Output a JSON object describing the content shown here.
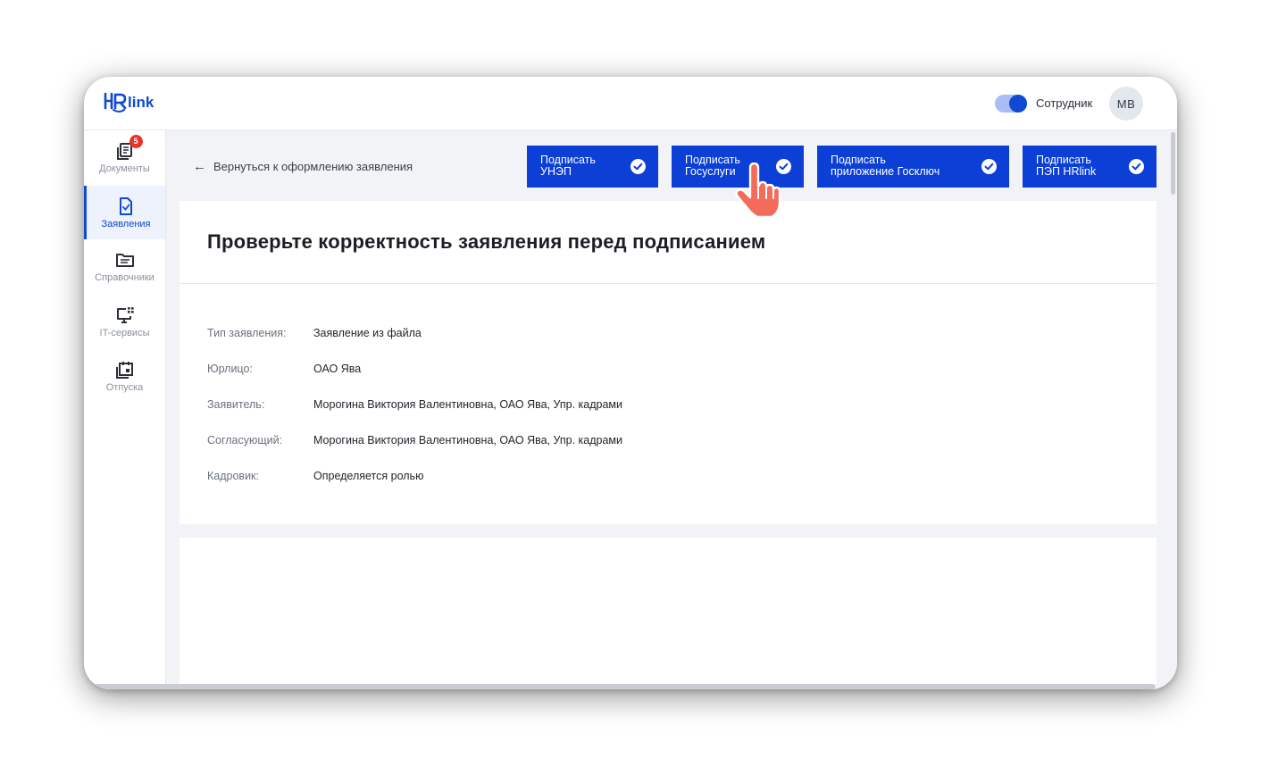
{
  "header": {
    "logo_text": "HRlink",
    "role_toggle_on": true,
    "role_label": "Сотрудник",
    "avatar_initials": "МВ"
  },
  "sidebar": {
    "items": [
      {
        "label": "Документы",
        "icon": "documents-icon",
        "badge": "5"
      },
      {
        "label": "Заявления",
        "icon": "application-icon",
        "active": true
      },
      {
        "label": "Справочники",
        "icon": "folder-icon"
      },
      {
        "label": "IT-сервисы",
        "icon": "it-services-icon"
      },
      {
        "label": "Отпуска",
        "icon": "calendar-icon"
      }
    ]
  },
  "toolbar": {
    "back_label": "Вернуться к оформлению заявления",
    "buttons": [
      {
        "line1": "Подписать",
        "line2": "УНЭП"
      },
      {
        "line1": "Подписать",
        "line2": "Госуслуги"
      },
      {
        "line1": "Подписать",
        "line2": "приложение Госключ"
      },
      {
        "line1": "Подписать",
        "line2": "ПЭП HRlink"
      }
    ]
  },
  "main": {
    "title": "Проверьте корректность заявления перед подписанием",
    "fields": [
      {
        "key": "Тип заявления:",
        "value": "Заявление из файла"
      },
      {
        "key": "Юрлицо:",
        "value": "ОАО Ява"
      },
      {
        "key": "Заявитель:",
        "value": "Морогина Виктория Валентиновна, ОАО Ява, Упр. кадрами"
      },
      {
        "key": "Согласующий:",
        "value": "Морогина Виктория Валентиновна, ОАО Ява, Упр. кадрами"
      },
      {
        "key": "Кадровик:",
        "value": "Определяется ролью"
      }
    ]
  },
  "colors": {
    "accent": "#0b3fd6",
    "badge": "#e8332a",
    "cursor": "#f26b5b"
  }
}
